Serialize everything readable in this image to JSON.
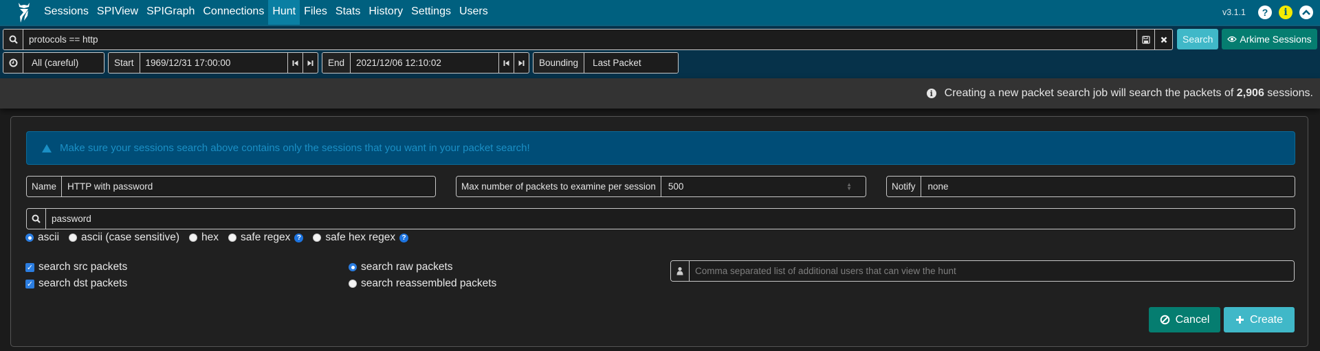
{
  "nav": {
    "items": [
      {
        "label": "Sessions",
        "active": false
      },
      {
        "label": "SPIView",
        "active": false
      },
      {
        "label": "SPIGraph",
        "active": false
      },
      {
        "label": "Connections",
        "active": false
      },
      {
        "label": "Hunt",
        "active": true
      },
      {
        "label": "Files",
        "active": false
      },
      {
        "label": "Stats",
        "active": false
      },
      {
        "label": "History",
        "active": false
      },
      {
        "label": "Settings",
        "active": false
      },
      {
        "label": "Users",
        "active": false
      }
    ],
    "version": "v3.1.1",
    "icons": {
      "help": "?",
      "info": "i",
      "collapse": "^"
    }
  },
  "search": {
    "query": "protocols == http",
    "search_label": "Search",
    "arkime_sessions_label": "Arkime Sessions",
    "time_range": "All (careful)",
    "start_label": "Start",
    "start_value": "1969/12/31 17:00:00",
    "end_label": "End",
    "end_value": "2021/12/06 12:10:02",
    "bounding_label": "Bounding",
    "bounding_value": "Last Packet"
  },
  "info": {
    "prefix": "Creating a new packet search job will search the packets of",
    "count": "2,906",
    "suffix": "sessions."
  },
  "form": {
    "alert": "Make sure your sessions search above contains only the sessions that you want in your packet search!",
    "name_label": "Name",
    "name_value": "HTTP with password",
    "max_label": "Max number of packets to examine per session",
    "max_value": "500",
    "notify_label": "Notify",
    "notify_value": "none",
    "search_text": "password",
    "search_types": [
      {
        "label": "ascii",
        "checked": true,
        "help": false
      },
      {
        "label": "ascii (case sensitive)",
        "checked": false,
        "help": false
      },
      {
        "label": "hex",
        "checked": false,
        "help": false
      },
      {
        "label": "safe regex",
        "checked": false,
        "help": true
      },
      {
        "label": "safe hex regex",
        "checked": false,
        "help": true
      }
    ],
    "src_packets_label": "search src packets",
    "src_packets_checked": true,
    "dst_packets_label": "search dst packets",
    "dst_packets_checked": true,
    "raw_packets_label": "search raw packets",
    "raw_packets_checked": true,
    "reassembled_packets_label": "search reassembled packets",
    "reassembled_packets_checked": false,
    "users_placeholder": "Comma separated list of additional users that can view the hunt",
    "cancel_label": "Cancel",
    "create_label": "Create"
  }
}
